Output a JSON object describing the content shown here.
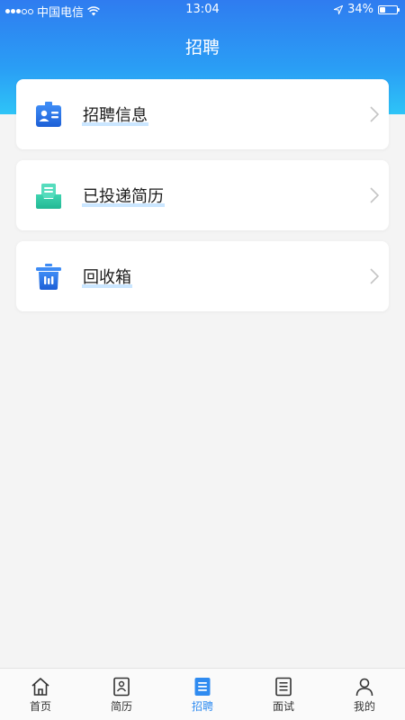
{
  "status_bar": {
    "carrier": "中国电信",
    "time": "13:04",
    "battery": "34%",
    "battery_level": 0.34
  },
  "header": {
    "title": "招聘"
  },
  "menu": {
    "items": [
      {
        "label": "招聘信息",
        "icon": "id-card-icon"
      },
      {
        "label": "已投递简历",
        "icon": "inbox-tray-icon"
      },
      {
        "label": "回收箱",
        "icon": "trash-bin-icon"
      }
    ]
  },
  "tab_bar": {
    "items": [
      {
        "label": "首页",
        "icon": "home-icon"
      },
      {
        "label": "简历",
        "icon": "resume-icon"
      },
      {
        "label": "招聘",
        "icon": "list-doc-icon",
        "active": true
      },
      {
        "label": "面试",
        "icon": "document-icon"
      },
      {
        "label": "我的",
        "icon": "person-icon"
      }
    ]
  },
  "colors": {
    "header_gradient_top": "#2f7cf0",
    "header_gradient_bottom": "#2ec4f7",
    "active_tab": "#2f8bf0",
    "background": "#f4f4f4"
  }
}
